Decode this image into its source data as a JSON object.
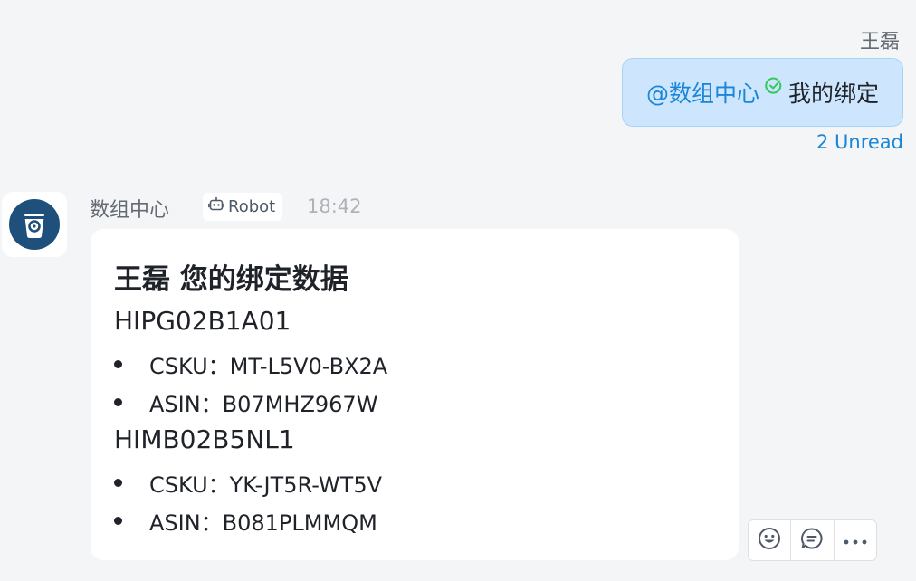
{
  "outgoing": {
    "sender": "王磊",
    "mention": "@数组中心",
    "text": "我的绑定",
    "unread": "2 Unread"
  },
  "incoming": {
    "sender": "数组中心",
    "tag": "Robot",
    "time": "18:42",
    "title": "王磊 您的绑定数据",
    "groups": [
      {
        "heading": "HIPG02B1A01",
        "items": [
          "CSKU：MT-L5V0-BX2A",
          "ASIN：B07MHZ967W"
        ]
      },
      {
        "heading": "HIMB02B5NL1",
        "items": [
          "CSKU：YK-JT5R-WT5V",
          "ASIN：B081PLMMQM"
        ]
      }
    ]
  },
  "icons": {
    "check": "check-circle-icon",
    "avatar": "cup-logo-icon",
    "robot": "robot-icon",
    "emoji": "emoji-icon",
    "reply": "comment-icon",
    "more": "more-icon"
  },
  "colors": {
    "accent": "#1a86d8",
    "check": "#34c759",
    "bubble": "#cde6fd",
    "avatar": "#1f4f7b"
  }
}
